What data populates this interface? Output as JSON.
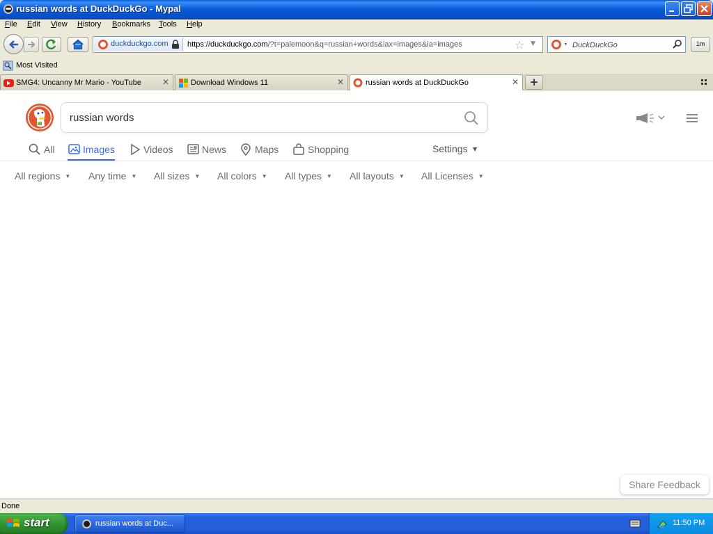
{
  "window": {
    "title": "russian words at DuckDuckGo - Mypal"
  },
  "menu": [
    "File",
    "Edit",
    "View",
    "History",
    "Bookmarks",
    "Tools",
    "Help"
  ],
  "menu_accel": [
    "F",
    "E",
    "V",
    "H",
    "B",
    "T",
    "H"
  ],
  "navbar": {
    "identity": "duckduckgo.com",
    "url_host": "https://duckduckgo.com",
    "url_rest": "/?t=palemoon&q=russian+words&iax=images&ia=images",
    "search_placeholder": "DuckDuckGo",
    "addon_label": "1m"
  },
  "bookmarks": {
    "most_visited": "Most Visited"
  },
  "tabs": [
    {
      "label": "SMG4: Uncanny Mr Mario - YouTube",
      "icon": "youtube-icon"
    },
    {
      "label": "Download Windows 11",
      "icon": "windows-icon"
    },
    {
      "label": "russian words at DuckDuckGo",
      "icon": "duckduckgo-icon",
      "active": true
    }
  ],
  "page": {
    "query": "russian words",
    "nav_tabs": [
      "All",
      "Images",
      "Videos",
      "News",
      "Maps",
      "Shopping"
    ],
    "active_tab": "Images",
    "settings": "Settings",
    "filters": [
      "All regions",
      "Any time",
      "All sizes",
      "All colors",
      "All types",
      "All layouts",
      "All Licenses"
    ],
    "share_feedback": "Share Feedback"
  },
  "status": {
    "text": "Done"
  },
  "taskbar": {
    "start": "start",
    "task": "russian words at Duc...",
    "clock": "11:50 PM"
  },
  "colors": {
    "accent": "#3969ef",
    "title_bar": "#0a5fd8",
    "ddg_orange": "#de5833"
  }
}
